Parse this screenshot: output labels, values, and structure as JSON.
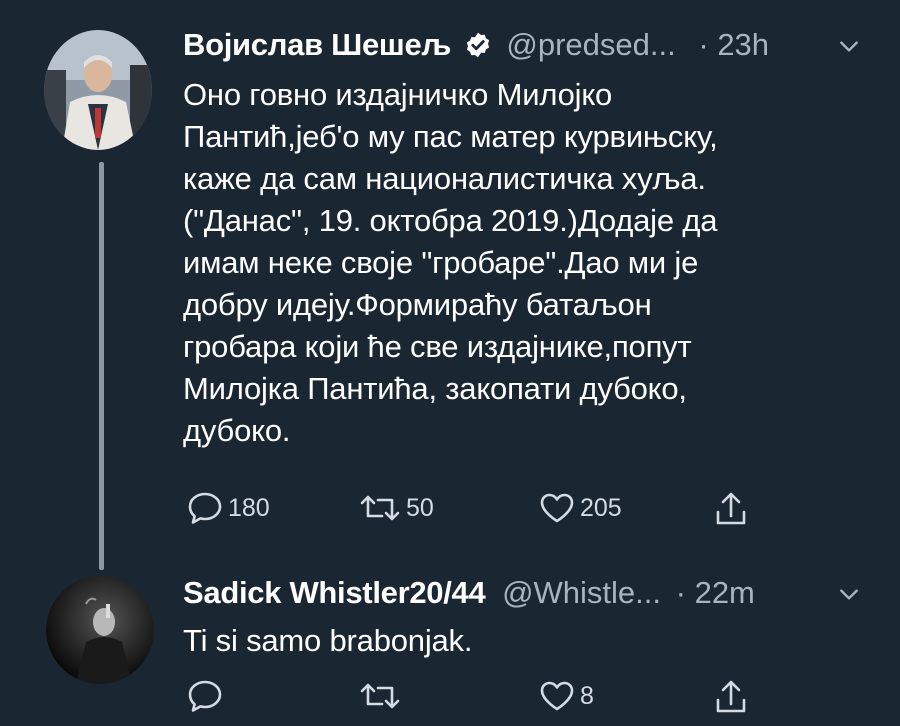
{
  "tweets": [
    {
      "author_name": "Војислав Шешељ",
      "handle": "@predsed...",
      "dot": "·",
      "time": "23h",
      "verified": true,
      "text": "Оно говно издајничко Милојко\nПантић,јеб'о му пас матер курвињску,\nкаже да сам националистичка хуља.\n(\"Данас\", 19. октобра 2019.)Додаје да\nимам неке своје \"гробаре\".Дао ми је\nдобру идеју.Формираћу батаљон\nгробара који ће све издајнике,попут\nМилојка Пантића, закопати дубоко,\nдубоко.",
      "replies": "180",
      "retweets": "50",
      "likes": "205"
    },
    {
      "author_name": "Sadick Whistler20/44",
      "handle": "@Whistle...",
      "dot": "·",
      "time": "22m",
      "verified": false,
      "text": "Ti si samo brabonjak.",
      "replies": "",
      "retweets": "",
      "likes": "8"
    }
  ],
  "icons": {
    "reply": "reply-icon",
    "retweet": "retweet-icon",
    "like": "heart-icon",
    "share": "share-icon",
    "more": "chevron-down-icon",
    "verified": "verified-badge-icon"
  },
  "colors": {
    "background": "#1b2633",
    "text": "#ffffff",
    "secondary": "#a9b4c0",
    "thread_line": "#8b98a5"
  }
}
